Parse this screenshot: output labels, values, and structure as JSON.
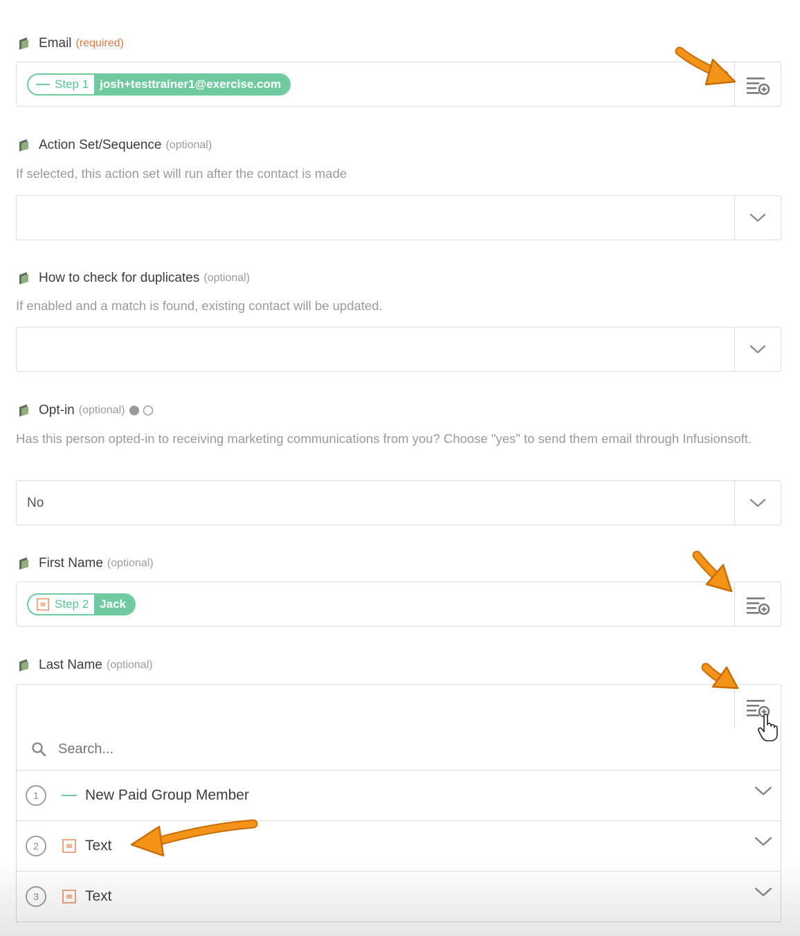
{
  "fields": {
    "email": {
      "label": "Email",
      "note": "(required)",
      "step": "Step 1",
      "value": "josh+testtrainer1@exercise.com"
    },
    "action_set": {
      "label": "Action Set/Sequence",
      "note": "(optional)",
      "help": "If selected, this action set will run after the contact is made",
      "value": ""
    },
    "duplicates": {
      "label": "How to check for duplicates",
      "note": "(optional)",
      "help": "If enabled and a match is found, existing contact will be updated.",
      "value": ""
    },
    "optin": {
      "label": "Opt-in",
      "note": "(optional)",
      "help": "Has this person opted-in to receiving marketing communications from you? Choose \"yes\" to send them email through Infusionsoft.",
      "value": "No"
    },
    "first_name": {
      "label": "First Name",
      "note": "(optional)",
      "step": "Step 2",
      "value": "Jack"
    },
    "last_name": {
      "label": "Last Name",
      "note": "(optional)",
      "value": ""
    }
  },
  "dropdown": {
    "search_placeholder": "Search...",
    "options": [
      {
        "num": "1",
        "label": "New Paid Group Member",
        "icon": "dash-app-icon"
      },
      {
        "num": "2",
        "label": "Text",
        "icon": "orange-app-icon"
      },
      {
        "num": "3",
        "label": "Text",
        "icon": "orange-app-icon"
      }
    ]
  },
  "colors": {
    "accent_green": "#6fcaa0",
    "required_orange": "#e2773c",
    "arrow_orange": "#f39419"
  }
}
